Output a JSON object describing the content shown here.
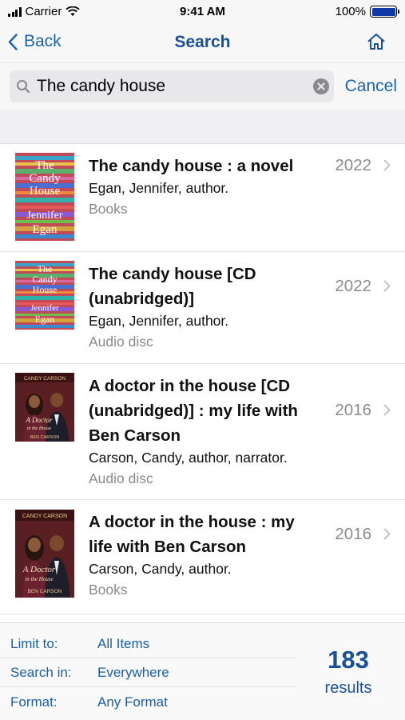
{
  "status_bar": {
    "carrier": "Carrier",
    "time": "9:41 AM",
    "battery": "100%"
  },
  "nav": {
    "back_label": "Back",
    "title": "Search"
  },
  "search": {
    "value": "The candy house",
    "cancel_label": "Cancel"
  },
  "results": [
    {
      "title": "The candy house : a novel",
      "author": "Egan, Jennifer, author.",
      "format": "Books",
      "year": "2022",
      "cover_text": "The Candy House Jennifer Egan"
    },
    {
      "title": "The candy house [CD (unabridged)]",
      "author": "Egan, Jennifer, author.",
      "format": "Audio disc",
      "year": "2022",
      "cover_text": "The Candy House Jennifer Egan"
    },
    {
      "title": "A doctor in the house [CD (unabridged)] : my life with Ben Carson",
      "author": "Carson, Candy, author, narrator.",
      "format": "Audio disc",
      "year": "2016",
      "cover_text": "CANDY CARSON A Doctor in the House BEN CARSON"
    },
    {
      "title": "A doctor in the house : my life with Ben Carson",
      "author": "Carson, Candy, author.",
      "format": "Books",
      "year": "2016",
      "cover_text": "CANDY CARSON A Doctor in the House BEN CARSON"
    }
  ],
  "footer": {
    "limit_label": "Limit to:",
    "limit_value": "All Items",
    "search_in_label": "Search in:",
    "search_in_value": "Everywhere",
    "format_label": "Format:",
    "format_value": "Any Format",
    "count": "183",
    "count_label": "results"
  },
  "colors": {
    "accent": "#1a63b3",
    "title_blue": "#1a4f9a",
    "secondary_text": "#8a8a8a"
  }
}
